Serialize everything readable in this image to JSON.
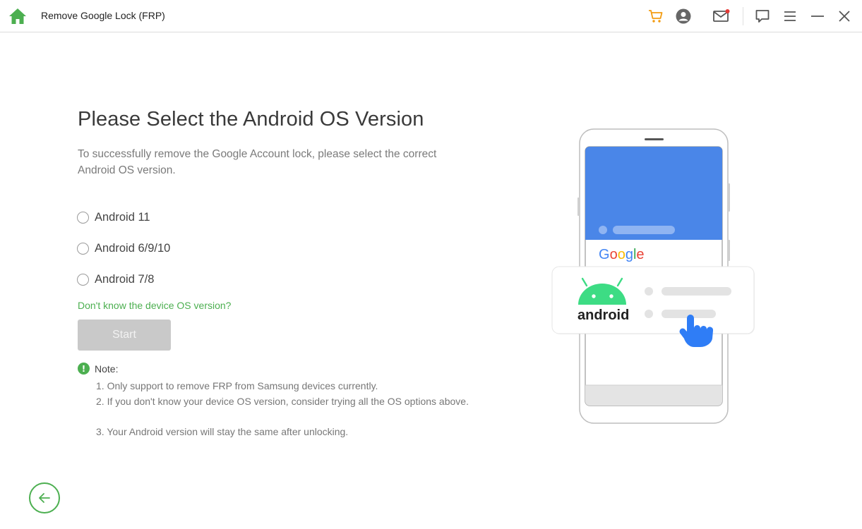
{
  "window": {
    "title": "Remove Google Lock (FRP)"
  },
  "toolbar": {
    "icons": [
      "home-icon",
      "cart-icon",
      "account-icon",
      "mail-icon",
      "feedback-icon",
      "menu-icon",
      "minimize-icon",
      "close-icon"
    ]
  },
  "main": {
    "title": "Please Select the Android OS Version",
    "subtitle": "To successfully remove the Google Account lock, please select the correct Android OS version.",
    "options": [
      {
        "label": "Android 11",
        "selected": false
      },
      {
        "label": "Android 6/9/10",
        "selected": false
      },
      {
        "label": "Android 7/8",
        "selected": false
      }
    ],
    "help_link": "Don't know the device OS version?",
    "start_label": "Start",
    "note": {
      "title": "Note:",
      "items": [
        "1. Only support to remove FRP from Samsung devices currently.",
        "2. If you don't know your device OS version, consider trying all the OS options above.",
        "3. Your Android version will stay the same after unlocking."
      ]
    }
  },
  "illustration": {
    "google_text": "Google",
    "android_text": "android"
  },
  "colors": {
    "accent": "#4caf50",
    "google_blue": "#4a86e8",
    "android_green": "#3ddc84",
    "disabled_button": "#c9c9c9"
  }
}
